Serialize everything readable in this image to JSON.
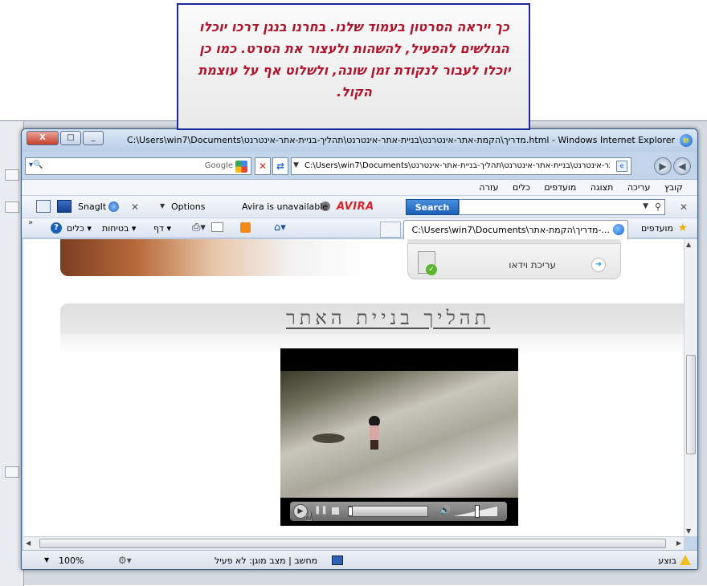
{
  "callout": {
    "text": "כך ייראה הסרטון בעמוד שלנו. בחרנו בנגן דרכו יוכלו הגולשים להפעיל, להשהות ולעצור את הסרט. כמו כן יוכלו לעבור לנקודת זמן שונה, ולשלוט אף על עוצמת הקול."
  },
  "window": {
    "title": "C:\\Users\\win7\\Documents\\מדריך\\הקמת-אתר-אינטרנט\\בניית-אתר-אינטרנט\\תהליך-בניית-אתר-אינטרנט.html - Windows Internet Explorer",
    "close_label": "X",
    "max_label": "□",
    "min_label": "_"
  },
  "address_bar": {
    "url": "C:\\Users\\win7\\Documents\\מדריך\\הקמת-אתר-אינטרנט\\בניית-אתר-אינטרנט\\תהליך-בניית-אתר-אינטרנט\\",
    "google_placeholder": "Google"
  },
  "menu": {
    "items": [
      "קובץ",
      "עריכה",
      "תצוגה",
      "מועדפים",
      "כלים",
      "עזרה"
    ]
  },
  "toolbar": {
    "search_button": "Search",
    "avira_logo": "AVIRA",
    "avira_status": "Avira is unavailable",
    "options_label": "Options",
    "snagit_label": "SnagIt"
  },
  "favorites_bar": {
    "label": "מועדפים",
    "tab_title": "C:\\Users\\win7\\Documents\\מדריך\\הקמת-אתר-...",
    "page_label": "דף",
    "safety_label": "בטיחות",
    "tools_label": "כלים",
    "help_label": "?"
  },
  "content": {
    "video_edit_label": "עריכת וידאו",
    "section_title": "תהליך בניית האתר"
  },
  "video_player": {
    "progress": 0.0,
    "volume": 0.55
  },
  "status_bar": {
    "done_label": "בוצע",
    "zone_label": "מחשב | מצב מוגן: לא פעיל",
    "zoom_label": "100%"
  },
  "colors": {
    "callout_text": "#b0142a",
    "callout_border": "#1a2a9e",
    "search_button": "#1b5fb6",
    "avira": "#d8232a"
  }
}
